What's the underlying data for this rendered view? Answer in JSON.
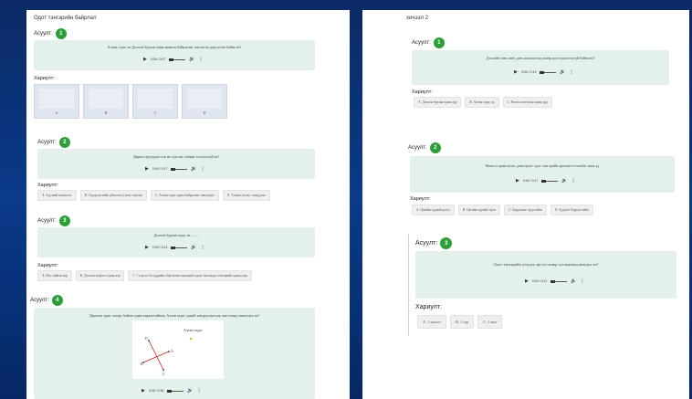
{
  "left": {
    "title": "Одот тэнгэрийн байрлал",
    "answer_label": "Хариулт:",
    "q1": {
      "label": "Асуулт",
      "num": "1",
      "text": "Алгив гадас нь Долоон бурхан одны аравын байрлалыг зөв ам ам дурсагтан байна вэ?",
      "time": "0:00 / 0:07",
      "image_options": [
        "A",
        "B",
        "C",
        "D"
      ]
    },
    "q2": {
      "label": "Асуулт",
      "num": "2",
      "text": "Дараах аргуудаас аль нь хүн чиг хоёрыг тогтоохгүй вэ?",
      "time": "0:00 / 0:17",
      "options": [
        "A. Зүүлний шинэгээс",
        "B. Гадар нутгийн үйлчлагч уулаг, тэрхаас",
        "C. Алтан гадас одны байрлалыг зөвлөгдөх",
        "D. Тэнцэл ухсан, тэнцүүлэх"
      ]
    },
    "q3": {
      "label": "Асуулт",
      "num": "3",
      "text": "Долоон бурхан гадас нь ........",
      "time": "0:00 / 0:14",
      "options": [
        "A. Нэг хийвэн нэр",
        "B. Долоон хөгрөлт одны нэр",
        "C. 7 нэр ол би гүүрийн обрглахчээ ерөнхий гадаас батлагдах тэнгэрийн одоны нэр"
      ]
    },
    "q4": {
      "label": "Асуулт",
      "num": "4",
      "text": "Дараахи зураг хагарт байгаа одны нарталтайнаас Алтан гадас одыей хаворуулын аль чигтэшид зөвлөгдөх вэ?",
      "diagram_caption": "Алтан гадас",
      "diagram_letters": [
        "A",
        "B",
        "C",
        "D"
      ],
      "time": "0:00 / 0:30"
    }
  },
  "right": {
    "title": "хичээл 2",
    "answer_label": "Хариулт:",
    "q1": {
      "label": "Асуулт",
      "num": "1",
      "text": "Дэлхийн зөвх ханг, даеь шашлагчид жинр ид тогдоогоохгүй байна вэ?",
      "time": "0:00 / 0:19",
      "options": [
        "A. Долоон бурхан одны орд",
        "B. Алтан гадас од",
        "C. Өлөөс шалтгаан одны орд"
      ]
    },
    "q2": {
      "label": "Асуулт",
      "num": "2",
      "text": "Монгол орны нутаг дэвсгэрээс одот тэнгэрийн орчлонтгэ-чигийг знаж үү",
      "time": "0:00 / 0:17",
      "options": [
        "A. Цагийн зүүний дагуу",
        "B. Цагийн зүүний эсрэг",
        "C. Баруунаас зүүн тийш",
        "D. Зүүнээс баруун тийш"
      ]
    },
    "q3": {
      "label": "Асуулт",
      "num": "3",
      "text": "Одот тэнгэрийн үзэгдэх эргэлт жинр хугацааанд явагдах вэ?",
      "time": "0:00 / 0:11",
      "options": [
        "A. 1 хоногт",
        "B. 1 сар",
        "C. 1 жил"
      ]
    }
  }
}
